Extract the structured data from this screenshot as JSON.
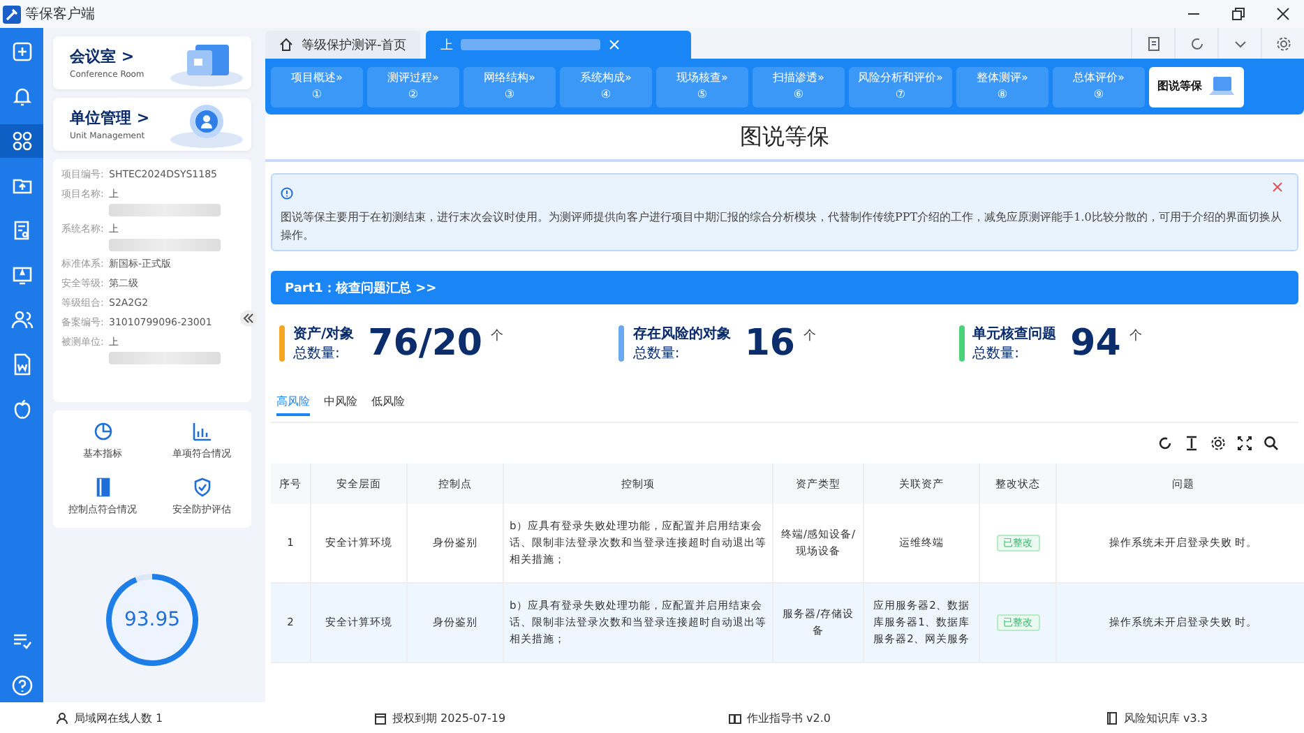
{
  "app_title": "等保客户端",
  "rail": [
    {
      "selected": false
    },
    {
      "selected": false
    },
    {
      "selected": true
    },
    {
      "selected": false
    },
    {
      "selected": false
    },
    {
      "selected": false
    },
    {
      "selected": false
    },
    {
      "selected": false
    },
    {
      "selected": false
    }
  ],
  "side_cards": [
    {
      "title": "会议室 >",
      "subtitle": "Conference Room"
    },
    {
      "title": "单位管理 >",
      "subtitle": "Unit Management"
    }
  ],
  "project_info": [
    {
      "label": "项目编号:",
      "value": "SHTEC2024DSYS1185",
      "kind": "plain"
    },
    {
      "label": "项目名称:",
      "value": "上",
      "kind": "blurred"
    },
    {
      "label": "系统名称:",
      "value": "上",
      "kind": "blurred"
    },
    {
      "label": "标准体系:",
      "value": "新国标-正式版",
      "kind": "plain"
    },
    {
      "label": "安全等级:",
      "value": "第二级",
      "kind": "plain"
    },
    {
      "label": "等级组合:",
      "value": "S2A2G2",
      "kind": "plain"
    },
    {
      "label": "备案编号:",
      "value": "31010799096-23001",
      "kind": "plain"
    },
    {
      "label": "被测单位:",
      "value": "上",
      "kind": "blurred"
    }
  ],
  "shortcuts": [
    {
      "label": "基本指标"
    },
    {
      "label": "单项符合情况"
    },
    {
      "label": "控制点符合情况"
    },
    {
      "label": "安全防护评估"
    }
  ],
  "score": {
    "value": "93.95",
    "level": 0.94
  },
  "tabs": [
    {
      "label": "等级保护测评-首页",
      "selected": false,
      "kind": "home"
    },
    {
      "label": "上",
      "selected": true,
      "kind": "blurred"
    }
  ],
  "nav": [
    {
      "label": "项目概述»",
      "number": "①",
      "selected": false
    },
    {
      "label": "测评过程»",
      "number": "②",
      "selected": false
    },
    {
      "label": "网络结构»",
      "number": "③",
      "selected": false
    },
    {
      "label": "系统构成»",
      "number": "④",
      "selected": false
    },
    {
      "label": "现场核查»",
      "number": "⑤",
      "selected": false
    },
    {
      "label": "扫描渗透»",
      "number": "⑥",
      "selected": false
    },
    {
      "label": "风险分析和评价»",
      "number": "⑦",
      "selected": false
    },
    {
      "label": "整体测评»",
      "number": "⑧",
      "selected": false
    },
    {
      "label": "总体评价»",
      "number": "⑨",
      "selected": false
    },
    {
      "label": "图说等保",
      "selected": true
    }
  ],
  "banner_title": "图说等保",
  "notice": "图说等保主要用于在初测结束，进行末次会议时使用。为测评师提供向客户进行项目中期汇报的综合分析模块，代替制作传统PPT介绍的工作，减免应原测评能手1.0比较分散的，可用于介绍的界面切换从操作。",
  "part_title": "Part1：核查问题汇总 >>",
  "stats": [
    {
      "title": "资产/对象",
      "sub": "总数量:",
      "value": "76/20",
      "unit": "个",
      "color": "#f5a623"
    },
    {
      "title": "存在风险的对象",
      "sub": "总数量:",
      "value": "16",
      "unit": "个",
      "color": "#6aa8f0"
    },
    {
      "title": "单元核查问题",
      "sub": "总数量:",
      "value": "94",
      "unit": "个",
      "color": "#4cd37a"
    }
  ],
  "risk_tabs": [
    {
      "label": "高风险",
      "selected": true
    },
    {
      "label": "中风险",
      "selected": false
    },
    {
      "label": "低风险",
      "selected": false
    }
  ],
  "table": {
    "columns": [
      "序号",
      "安全层面",
      "控制点",
      "控制项",
      "资产类型",
      "关联资产",
      "整改状态",
      "问题"
    ],
    "rows": [
      {
        "cells": [
          "1",
          "安全计算环境",
          "身份鉴别",
          "b）应具有登录失败处理功能，应配置并启用结束会话、限制非法登录次数和当登录连接超时自动退出等相关措施；",
          "终端/感知设备/现场设备",
          "运维终端",
          "已整改",
          "操作系统未开启登录失败 时。"
        ],
        "selected": false
      },
      {
        "cells": [
          "2",
          "安全计算环境",
          "身份鉴别",
          "b）应具有登录失败处理功能，应配置并启用结束会话、限制非法登录次数和当登录连接超时自动退出等相关措施；",
          "服务器/存储设备",
          "应用服务器2、数据库服务器1、数据库服务器2、网关服务",
          "已整改",
          "操作系统未开启登录失败 时。"
        ],
        "selected": true
      }
    ]
  },
  "status": [
    {
      "text": "局域网在线人数 1"
    },
    {
      "text": "授权到期 2025-07-19"
    },
    {
      "text": "作业指导书 v2.0"
    },
    {
      "text": "风险知识库 v3.3"
    }
  ]
}
